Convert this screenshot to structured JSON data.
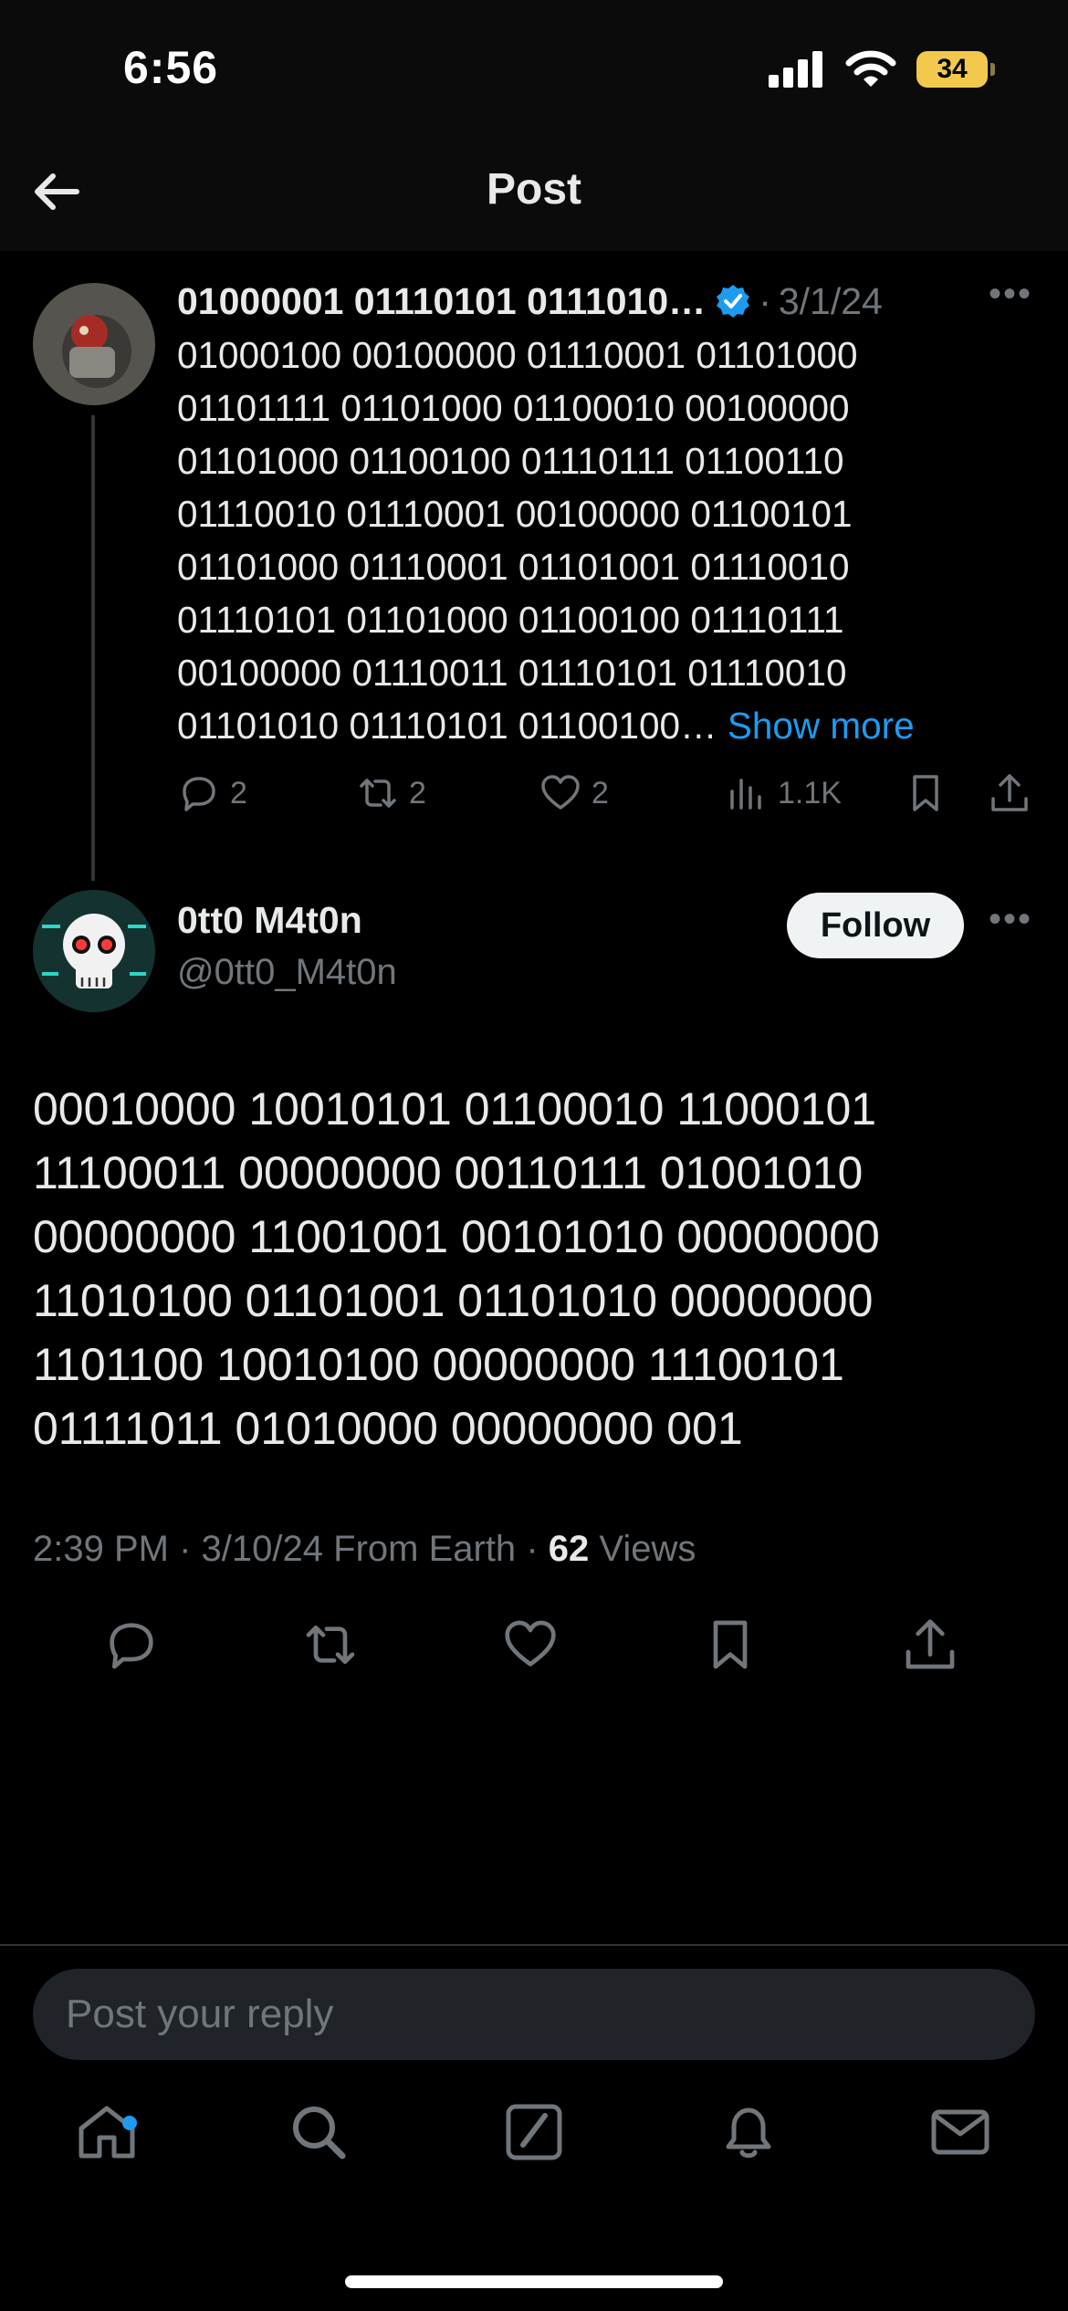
{
  "status_bar": {
    "time": "6:56",
    "battery": "34"
  },
  "header": {
    "title": "Post"
  },
  "parent_post": {
    "display_name": "01000001 01110101 0111010…",
    "separator": "·",
    "date": "3/1/24",
    "body": "01000100 00100000 01110001 01101000\n01101111 01101000 01100010 00100000\n01101000 01100100 01110111 01100110\n01110010 01110001 00100000 01100101\n01101000 01110001 01101001 01110010\n01110101 01101000 01100100 01110111\n00100000 01110011 01110101 01110010\n01101010 01110101 01100100…",
    "show_more": "Show more",
    "replies": "2",
    "reposts": "2",
    "likes": "2",
    "views": "1.1K"
  },
  "main_post": {
    "display_name": "0tt0 M4t0n",
    "handle": "@0tt0_M4t0n",
    "follow_label": "Follow",
    "body": "00010000 10010101 01100010 11000101\n11100011 00000000 00110111 01001010\n00000000 11001001 00101010 00000000\n11010100 01101001 01101010 00000000\n1101100 10010100 00000000 11100101\n01111011 01010000 00000000 001",
    "time": "2:39 PM",
    "date": "3/10/24",
    "source": "From Earth",
    "views_count": "62",
    "views_label": "Views",
    "separator": "·"
  },
  "reply": {
    "placeholder": "Post your reply"
  },
  "tabs": [
    "home-icon",
    "search-icon",
    "compose-icon",
    "notifications-icon",
    "messages-icon"
  ],
  "colors": {
    "accent": "#1d9bf0",
    "battery": "#f2c94c",
    "muted": "#71767b",
    "text": "#e7e9ea"
  }
}
